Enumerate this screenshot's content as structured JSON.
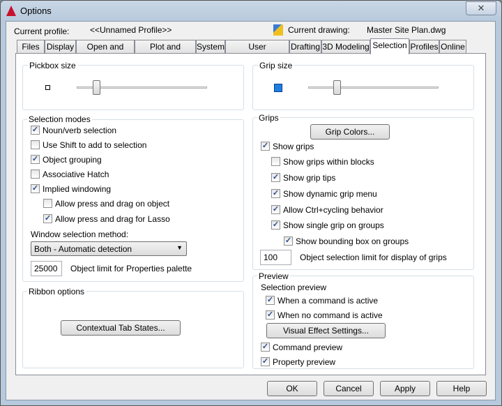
{
  "window": {
    "title": "Options",
    "close_icon": "close-icon"
  },
  "header": {
    "profile_label": "Current profile:",
    "profile_value": "<<Unnamed Profile>>",
    "drawing_label": "Current drawing:",
    "drawing_value": "Master Site Plan.dwg"
  },
  "tabs": [
    "Files",
    "Display",
    "Open and Save",
    "Plot and Publish",
    "System",
    "User Preferences",
    "Drafting",
    "3D Modeling",
    "Selection",
    "Profiles",
    "Online"
  ],
  "active_tab": "Selection",
  "pickbox": {
    "label": "Pickbox size",
    "slider_level": 0.15
  },
  "grip_size": {
    "label": "Grip size",
    "slider_level": 0.22,
    "color": "#1e7fe0"
  },
  "selection_modes": {
    "label": "Selection modes",
    "items": [
      {
        "label": "Noun/verb selection",
        "checked": true
      },
      {
        "label": "Use Shift to add to selection",
        "checked": false
      },
      {
        "label": "Object grouping",
        "checked": true
      },
      {
        "label": "Associative Hatch",
        "checked": false
      },
      {
        "label": "Implied windowing",
        "checked": true
      },
      {
        "label": "Allow press and drag on object",
        "checked": false
      },
      {
        "label": "Allow press and drag for Lasso",
        "checked": true
      }
    ],
    "window_method_label": "Window selection method:",
    "window_method_value": "Both - Automatic detection",
    "object_limit_value": "25000",
    "object_limit_label": "Object limit for Properties palette"
  },
  "ribbon": {
    "label": "Ribbon options",
    "button": "Contextual Tab States..."
  },
  "grips": {
    "label": "Grips",
    "button": "Grip Colors...",
    "items": [
      {
        "label": "Show grips",
        "checked": true
      },
      {
        "label": "Show grips within blocks",
        "checked": false
      },
      {
        "label": "Show grip tips",
        "checked": true
      },
      {
        "label": "Show dynamic grip menu",
        "checked": true
      },
      {
        "label": "Allow Ctrl+cycling behavior",
        "checked": true
      },
      {
        "label": "Show single grip on groups",
        "checked": true
      },
      {
        "label": "Show bounding box on groups",
        "checked": true
      }
    ],
    "limit_value": "100",
    "limit_label": "Object selection limit for display of grips"
  },
  "preview": {
    "label": "Preview",
    "selection_preview_label": "Selection preview",
    "items": [
      {
        "label": "When a command is active",
        "checked": true
      },
      {
        "label": "When no command is active",
        "checked": true
      },
      {
        "label": "Command preview",
        "checked": true
      },
      {
        "label": "Property preview",
        "checked": true
      }
    ],
    "button": "Visual Effect Settings..."
  },
  "footer": {
    "ok": "OK",
    "cancel": "Cancel",
    "apply": "Apply",
    "help": "Help"
  }
}
